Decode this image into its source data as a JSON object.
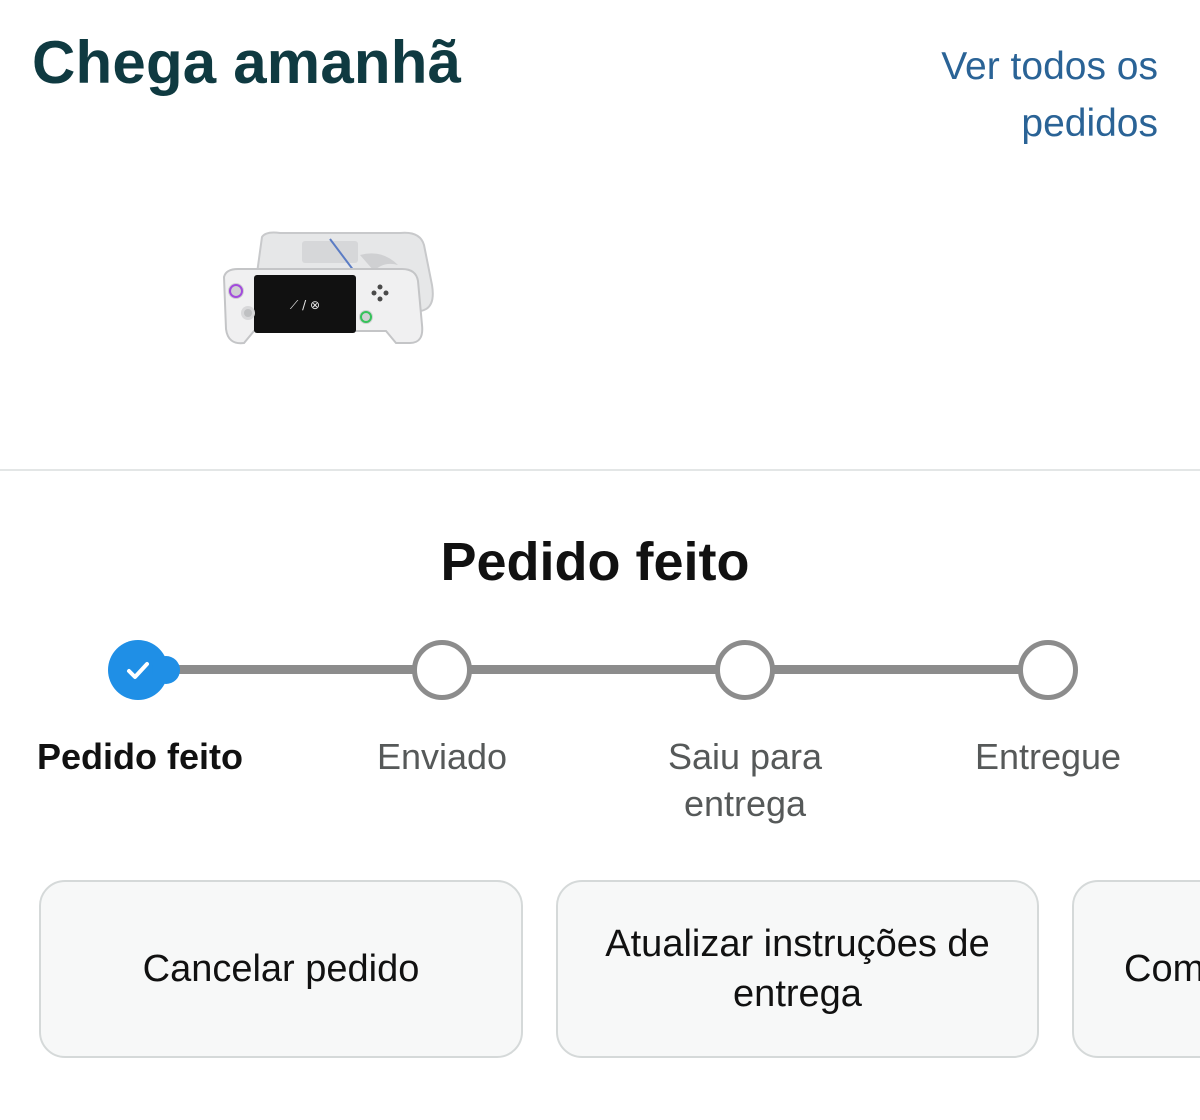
{
  "header": {
    "title": "Chega amanhã",
    "see_all_link": "Ver todos os pedidos"
  },
  "product": {
    "image_icon": "handheld-console-image",
    "screen_logo": "⟋ / ⊗"
  },
  "status": {
    "title": "Pedido feito",
    "progress_steps_completed": 1,
    "progress_steps_total": 4,
    "steps": [
      {
        "label": "Pedido feito",
        "state": "done"
      },
      {
        "label": "Enviado",
        "state": "pending"
      },
      {
        "label": "Saiu para entrega",
        "state": "pending"
      },
      {
        "label": "Entregue",
        "state": "pending"
      }
    ],
    "done_color": "#1f8fe6",
    "pending_color": "#8c8c8c",
    "check_icon": "checkmark-icon"
  },
  "actions": [
    {
      "label": "Cancelar pedido"
    },
    {
      "label": "Atualizar instruções de entrega"
    },
    {
      "label": "Com"
    }
  ],
  "colors": {
    "title": "#0f3a41",
    "link": "#2a6396",
    "button_bg": "#f7f8f8",
    "button_border": "#d5d9d9"
  }
}
